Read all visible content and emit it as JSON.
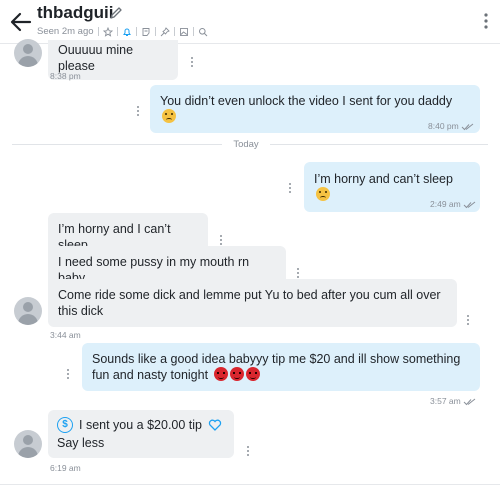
{
  "header": {
    "title": "thbadguii",
    "seen": "Seen 2m ago",
    "icons": [
      "back-arrow-icon",
      "pencil-icon",
      "star-icon",
      "bell-icon",
      "note-icon",
      "pin-icon",
      "image-icon",
      "search-icon",
      "more-vertical-icon"
    ]
  },
  "messages": [
    {
      "id": "m1",
      "direction": "incoming",
      "text": "Ouuuuu mine please",
      "time": "8:38 pm"
    },
    {
      "id": "m2",
      "direction": "outgoing",
      "text": "You didn’t even unlock the video I sent for you daddy",
      "emoji": "sad-face",
      "time": "8:40 pm"
    },
    {
      "id": "m3",
      "direction": "outgoing",
      "text": "I’m horny and can’t sleep",
      "emoji": "sad-face",
      "time": "2:49 am"
    },
    {
      "id": "m4",
      "direction": "incoming",
      "text": "I’m horny and I can’t sleep"
    },
    {
      "id": "m5",
      "direction": "incoming",
      "text": "I need some pussy in my mouth rn baby"
    },
    {
      "id": "m6",
      "direction": "incoming",
      "text": "Come ride some dick and lemme put Yu to bed after you cum all over this dick",
      "time": "3:44 am"
    },
    {
      "id": "m7",
      "direction": "outgoing",
      "text": "Sounds like a good idea babyyy tip me $20 and ill show something fun and nasty tonight",
      "emoji": "devil-face x3",
      "time": "3:57 am"
    },
    {
      "id": "m8",
      "direction": "incoming",
      "tip_text": "I sent you a $20.00 tip",
      "text": "Say less",
      "time": "6:19 am"
    }
  ],
  "day_divider": "Today",
  "colors": {
    "incoming_bubble": "#eef0f2",
    "outgoing_bubble": "#ddf0fb",
    "accent": "#1da1f2"
  }
}
